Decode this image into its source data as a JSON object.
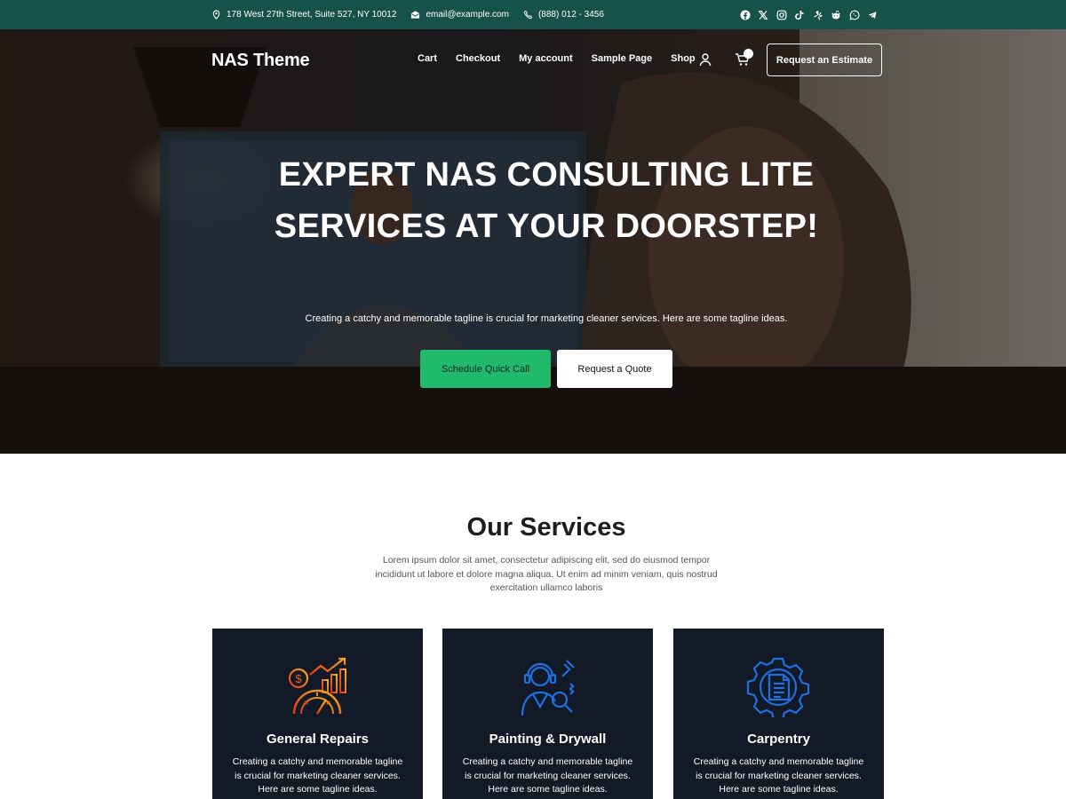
{
  "topbar": {
    "address": "178 West 27th Street, Suite 527, NY 10012",
    "email": "email@example.com",
    "phone": "(888) 012 - 3456",
    "socials": [
      "facebook-icon",
      "x-icon",
      "instagram-icon",
      "tiktok-icon",
      "yelp-icon",
      "reddit-icon",
      "whatsapp-icon",
      "telegram-icon"
    ]
  },
  "header": {
    "logo": "NAS Theme",
    "menu": [
      "Cart",
      "Checkout",
      "My account",
      "Sample Page",
      "Shop"
    ],
    "estimate_label": "Request an Estimate"
  },
  "hero": {
    "title": "EXPERT NAS CONSULTING LITE SERVICES AT YOUR DOORSTEP!",
    "subtitle": "Creating a catchy and memorable tagline is crucial for marketing cleaner services. Here are some tagline ideas.",
    "primary_button": "Schedule Quick Call",
    "secondary_button": "Request a Quote"
  },
  "services": {
    "title": "Our Services",
    "description": "Lorem ipsum dolor sit amet, consectetur adipiscing elit, sed do eiusmod tempor incididunt ut labore et dolore magna aliqua. Ut enim ad minim veniam, quis nostrud exercitation ullamco laboris",
    "cards": [
      {
        "title": "General Repairs",
        "text": "Creating a catchy and memorable tagline is crucial for marketing cleaner services. Here are some tagline ideas.",
        "icon": "finance-growth-icon"
      },
      {
        "title": "Painting & Drywall",
        "text": "Creating a catchy and memorable tagline is crucial for marketing cleaner services. Here are some tagline ideas.",
        "icon": "support-worker-icon"
      },
      {
        "title": "Carpentry",
        "text": "Creating a catchy and memorable tagline is crucial for marketing cleaner services. Here are some tagline ideas.",
        "icon": "document-gear-icon"
      }
    ]
  },
  "colors": {
    "topbar": "#17524a",
    "accent_green": "#21b96b",
    "card_bg": "#111a26",
    "icon_blue": "#1f6fe0",
    "icon_orange": "#f26a1b"
  }
}
